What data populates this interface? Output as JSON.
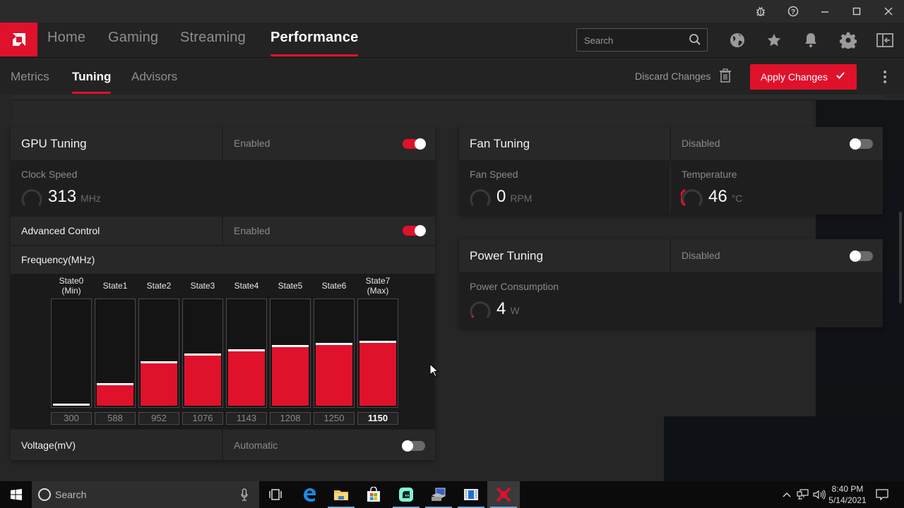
{
  "window": {
    "controls": [
      {
        "name": "bug-report-icon",
        "glyph": "bug"
      },
      {
        "name": "help-icon",
        "glyph": "?"
      },
      {
        "name": "minimize-icon",
        "glyph": "–"
      },
      {
        "name": "maximize-icon",
        "glyph": "□"
      },
      {
        "name": "close-icon",
        "glyph": "✕"
      }
    ]
  },
  "brand": {
    "accent": "#e0112b",
    "logo": "amd-logo"
  },
  "main_nav": {
    "tabs": [
      {
        "label": "Home",
        "active": false
      },
      {
        "label": "Gaming",
        "active": false
      },
      {
        "label": "Streaming",
        "active": false
      },
      {
        "label": "Performance",
        "active": true
      }
    ],
    "search_placeholder": "Search",
    "search_value": "",
    "header_icons": [
      "globe-icon",
      "star-icon",
      "bell-icon",
      "gear-icon",
      "exit-panel-icon"
    ]
  },
  "sub_nav": {
    "tabs": [
      {
        "label": "Metrics",
        "active": false
      },
      {
        "label": "Tuning",
        "active": true
      },
      {
        "label": "Advisors",
        "active": false
      }
    ],
    "discard_label": "Discard Changes",
    "apply_label": "Apply Changes"
  },
  "gpu_tuning": {
    "title": "GPU Tuning",
    "status": "Enabled",
    "enabled": true,
    "clock_speed": {
      "label": "Clock Speed",
      "value": "313",
      "unit": "MHz"
    },
    "advanced_control": {
      "label": "Advanced Control",
      "status": "Enabled",
      "enabled": true
    },
    "frequency": {
      "label": "Frequency(MHz)",
      "states": [
        {
          "label1": "State0",
          "label2": "(Min)",
          "value": "300",
          "fraction": 0.0
        },
        {
          "label1": "State1",
          "label2": "",
          "value": "588",
          "fraction": 0.19
        },
        {
          "label1": "State2",
          "label2": "",
          "value": "952",
          "fraction": 0.4
        },
        {
          "label1": "State3",
          "label2": "",
          "value": "1076",
          "fraction": 0.47
        },
        {
          "label1": "State4",
          "label2": "",
          "value": "1143",
          "fraction": 0.51
        },
        {
          "label1": "State5",
          "label2": "",
          "value": "1208",
          "fraction": 0.55
        },
        {
          "label1": "State6",
          "label2": "",
          "value": "1250",
          "fraction": 0.57
        },
        {
          "label1": "State7",
          "label2": "(Max)",
          "value": "1150",
          "fraction": 0.59,
          "active": true
        }
      ]
    },
    "voltage": {
      "label": "Voltage(mV)",
      "status": "Automatic",
      "enabled": false
    }
  },
  "fan_tuning": {
    "title": "Fan Tuning",
    "status": "Disabled",
    "enabled": false,
    "fan_speed": {
      "label": "Fan Speed",
      "value": "0",
      "unit": "RPM"
    },
    "temperature": {
      "label": "Temperature",
      "value": "46",
      "unit": "°C"
    }
  },
  "power_tuning": {
    "title": "Power Tuning",
    "status": "Disabled",
    "enabled": false,
    "power_consumption": {
      "label": "Power Consumption",
      "value": "4",
      "unit": "W"
    }
  },
  "taskbar": {
    "search_placeholder": "Search",
    "apps": [
      "task-view-icon",
      "edge-icon",
      "file-explorer-icon",
      "store-icon",
      "streamlabs-icon",
      "network-tool-icon",
      "media-app-icon",
      "amd-radeon-icon"
    ],
    "time": "8:40 PM",
    "date": "5/14/2021"
  }
}
